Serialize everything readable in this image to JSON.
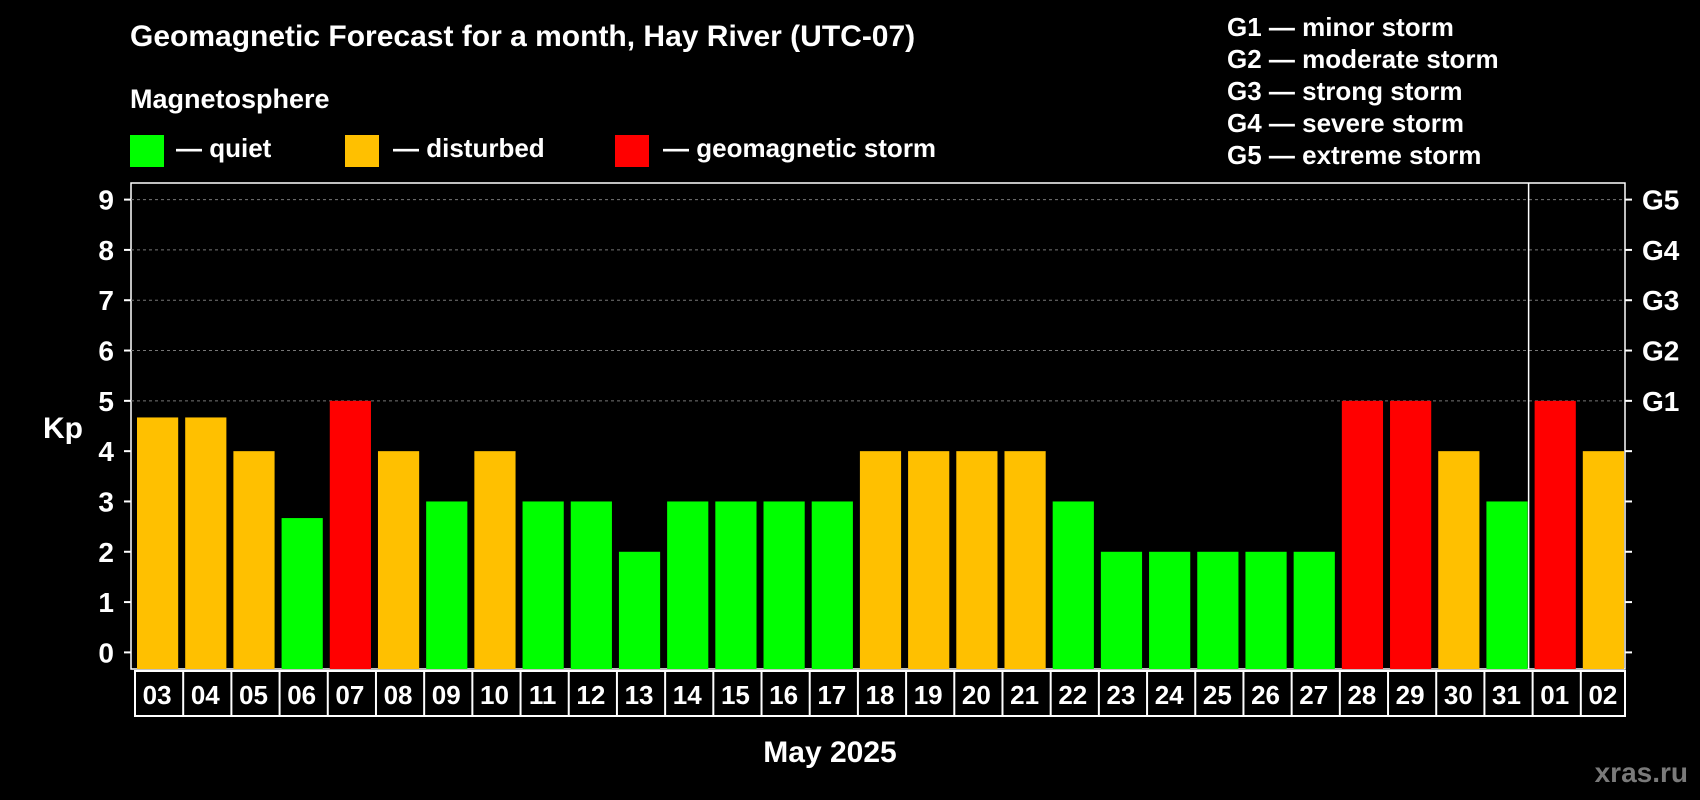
{
  "chart_data": {
    "type": "bar",
    "title": "Geomagnetic Forecast for a month, Hay River (UTC-07)",
    "subtitle": "Magnetosphere",
    "legend": [
      {
        "label": "— quiet",
        "color": "#00ff00"
      },
      {
        "label": "— disturbed",
        "color": "#ffc000"
      },
      {
        "label": "— geomagnetic storm",
        "color": "#ff0000"
      }
    ],
    "storm_scale": [
      "G1 — minor storm",
      "G2 — moderate storm",
      "G3 — strong storm",
      "G4 — severe storm",
      "G5 — extreme storm"
    ],
    "ylabel": "Kp",
    "ylim": [
      0,
      9
    ],
    "yticks": [
      0,
      1,
      2,
      3,
      4,
      5,
      6,
      7,
      8,
      9
    ],
    "right_ticks": [
      {
        "y": 5,
        "label": "G1"
      },
      {
        "y": 6,
        "label": "G2"
      },
      {
        "y": 7,
        "label": "G3"
      },
      {
        "y": 8,
        "label": "G4"
      },
      {
        "y": 9,
        "label": "G5"
      }
    ],
    "grid": "dashed at 5–9",
    "xlabel": "May 2025",
    "categories": [
      "03",
      "04",
      "05",
      "06",
      "07",
      "08",
      "09",
      "10",
      "11",
      "12",
      "13",
      "14",
      "15",
      "16",
      "17",
      "18",
      "19",
      "20",
      "21",
      "22",
      "23",
      "24",
      "25",
      "26",
      "27",
      "28",
      "29",
      "30",
      "31",
      "01",
      "02"
    ],
    "values": [
      4.67,
      4.67,
      4,
      2.67,
      5,
      4,
      3,
      4,
      3,
      3,
      2,
      3,
      3,
      3,
      3,
      4,
      4,
      4,
      4,
      3,
      2,
      2,
      2,
      2,
      2,
      5,
      5,
      4,
      3,
      5,
      4
    ],
    "month_divider_after": "31",
    "colors": {
      "quiet": "#00ff00",
      "disturbed": "#ffc000",
      "storm": "#ff0000"
    }
  },
  "watermark": "xras.ru"
}
